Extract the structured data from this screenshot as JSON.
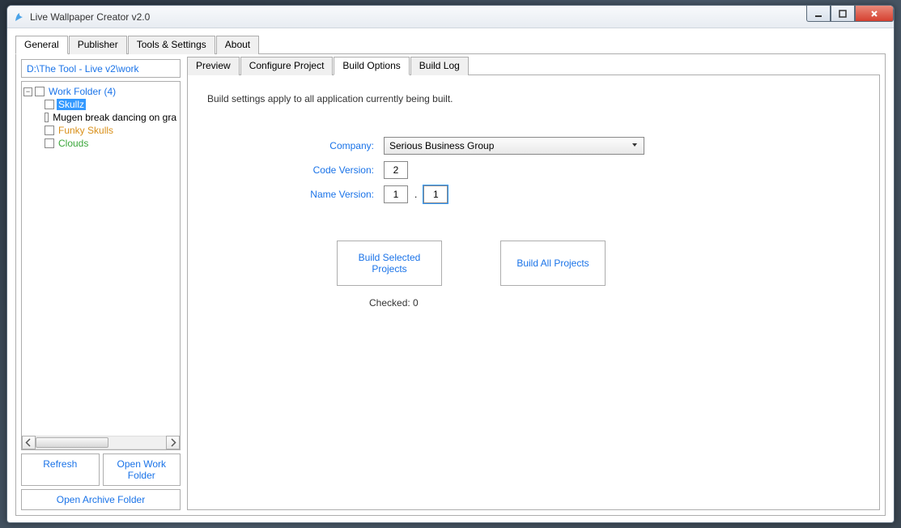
{
  "window": {
    "title": "Live Wallpaper Creator v2.0"
  },
  "tabs": {
    "general": "General",
    "publisher": "Publisher",
    "tools": "Tools & Settings",
    "about": "About"
  },
  "sidebar": {
    "path": "D:\\The Tool - Live v2\\work",
    "root_label": "Work Folder (4)",
    "items": [
      "Skullz",
      "Mugen break dancing on gra",
      "Funky Skulls",
      "Clouds"
    ],
    "refresh": "Refresh",
    "open_work": "Open Work Folder",
    "open_archive": "Open Archive Folder"
  },
  "subtabs": {
    "preview": "Preview",
    "configure": "Configure Project",
    "build": "Build Options",
    "log": "Build Log"
  },
  "build": {
    "description": "Build settings apply to all application currently being built.",
    "company_label": "Company:",
    "company_value": "Serious Business Group",
    "code_version_label": "Code Version:",
    "code_version_value": "2",
    "name_version_label": "Name Version:",
    "name_version_major": "1",
    "name_version_minor": "1",
    "build_selected": "Build Selected Projects",
    "build_all": "Build All Projects",
    "checked": "Checked: 0"
  }
}
